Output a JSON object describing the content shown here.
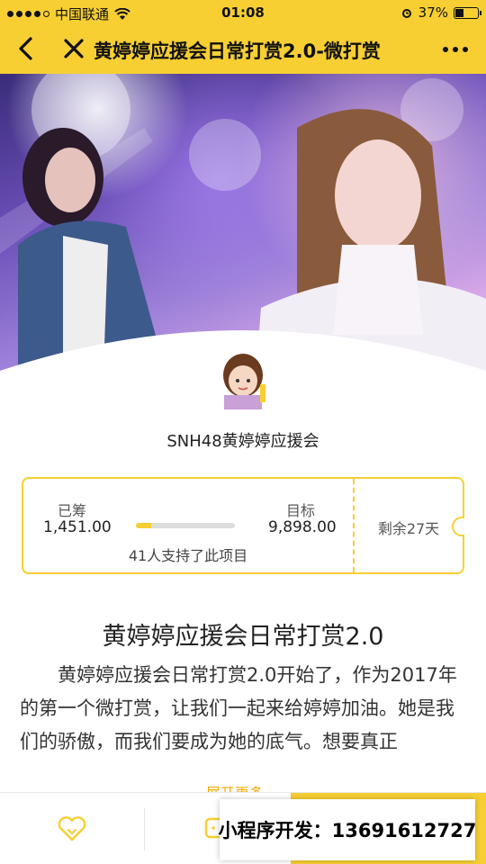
{
  "status_bar": {
    "carrier": "中国联通",
    "time": "01:08",
    "battery": "37%",
    "battery_level": 0.37
  },
  "nav": {
    "title": "黄婷婷应援会日常打赏2.0-微打赏"
  },
  "project": {
    "org_name": "SNH48黄婷婷应援会",
    "raised_label": "已筹",
    "raised_value": "1,451.00",
    "goal_label": "目标",
    "goal_value": "9,898.00",
    "progress": 0.15,
    "supporters_text": "41人支持了此项目",
    "remaining_text": "剩余27天"
  },
  "article": {
    "title": "黄婷婷应援会日常打赏2.0",
    "body": "黄婷婷应援会日常打赏2.0开始了，作为2017年的第一个微打赏，让我们一起来给婷婷加油。她是我们的骄傲，而我们要成为她的底气。想要真正",
    "expand_label": "展开更多"
  },
  "promo": {
    "text": "小程序开发：13691612727"
  },
  "colors": {
    "accent": "#f7cf33",
    "link": "#f7a800"
  },
  "icons": {
    "back": "chevron-left-icon",
    "close": "close-icon",
    "more": "more-dots-icon",
    "favorite": "heart-icon",
    "share": "chat-icon"
  }
}
